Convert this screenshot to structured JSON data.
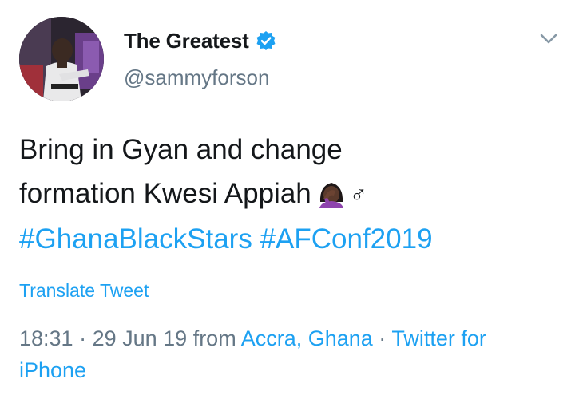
{
  "user": {
    "display_name": "The Greatest",
    "handle": "@sammyforson",
    "verified": true
  },
  "tweet": {
    "line1": "Bring in Gyan and change",
    "line2": "formation Kwesi Appiah",
    "male_sign": "♂",
    "hashtags": [
      "#GhanaBlackStars",
      "#AFConf2019"
    ]
  },
  "translate_label": "Translate Tweet",
  "meta": {
    "time": "18:31",
    "separator": " · ",
    "date": "29 Jun 19",
    "from_label": " from ",
    "location": "Accra, Ghana",
    "source_part1": "Twitter for",
    "source_part2": "iPhone"
  },
  "icons": {
    "verified": "verified-badge-icon",
    "menu": "chevron-down-icon",
    "emoji": "woman-facepalming-emoji"
  },
  "colors": {
    "link": "#1da1f2",
    "text": "#14171a",
    "secondary": "#657786"
  }
}
